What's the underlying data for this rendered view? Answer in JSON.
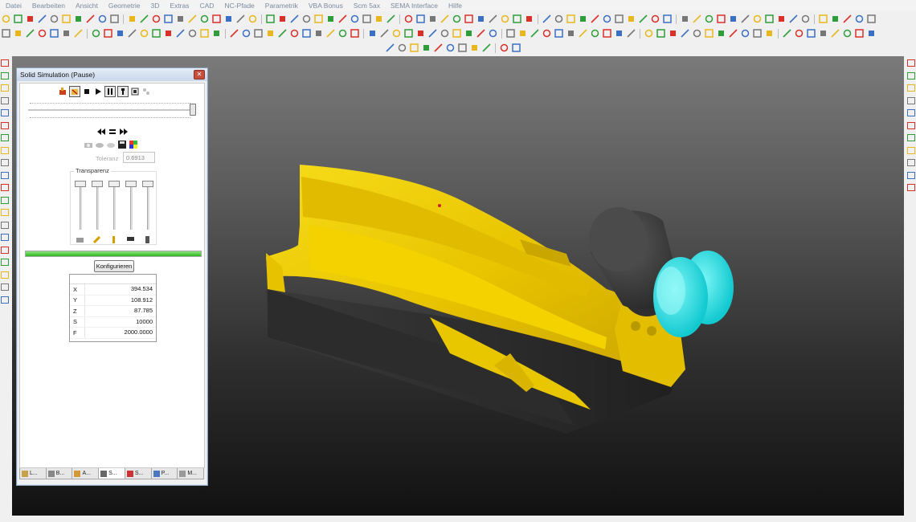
{
  "menu": [
    "Datei",
    "Bearbeiten",
    "Ansicht",
    "Geometrie",
    "3D",
    "Extras",
    "CAD",
    "NC-Pfade",
    "Parametrik",
    "VBA Bonus",
    "Scm 5ax",
    "SEMA Interface",
    "Hilfe"
  ],
  "panel": {
    "title": "Solid Simulation (Pause)",
    "close_label": "✕",
    "tolerance_label": "Toleranz",
    "tolerance_value": "0.6913",
    "transparency_label": "Transparenz",
    "progress_fraction": 1.0,
    "configure_label": "Konfigurieren",
    "coords": [
      {
        "key": "X",
        "value": "394.534"
      },
      {
        "key": "Y",
        "value": "108.912"
      },
      {
        "key": "Z",
        "value": "87.785"
      },
      {
        "key": "S",
        "value": "10000"
      },
      {
        "key": "F",
        "value": "2000.0000"
      }
    ],
    "playback_icons": [
      "tool-icon",
      "material-icon",
      "stop-icon",
      "play-icon",
      "pause-icon",
      "step-icon",
      "record-icon",
      "link-icon"
    ],
    "nav_icons": [
      "rewind-icon",
      "stop-small-icon",
      "fast-forward-icon"
    ],
    "tabs": [
      {
        "label": "L...",
        "icon": "folder-icon"
      },
      {
        "label": "B...",
        "icon": "layers-icon"
      },
      {
        "label": "A...",
        "icon": "part-icon"
      },
      {
        "label": "S...",
        "icon": "simulation-icon"
      },
      {
        "label": "S...",
        "icon": "settings-icon"
      },
      {
        "label": "P...",
        "icon": "path-icon"
      },
      {
        "label": "M...",
        "icon": "machine-icon"
      }
    ]
  },
  "toolbar_colors": {
    "red": "#d9302a",
    "yellow": "#e8b71d",
    "blue": "#3a6fc4",
    "green": "#2f9e3a",
    "gray": "#777777"
  },
  "scene": {
    "part_color": "#f2d000",
    "tool_holder_color": "#3c3c3c",
    "tool_color": "#22e0e6"
  }
}
